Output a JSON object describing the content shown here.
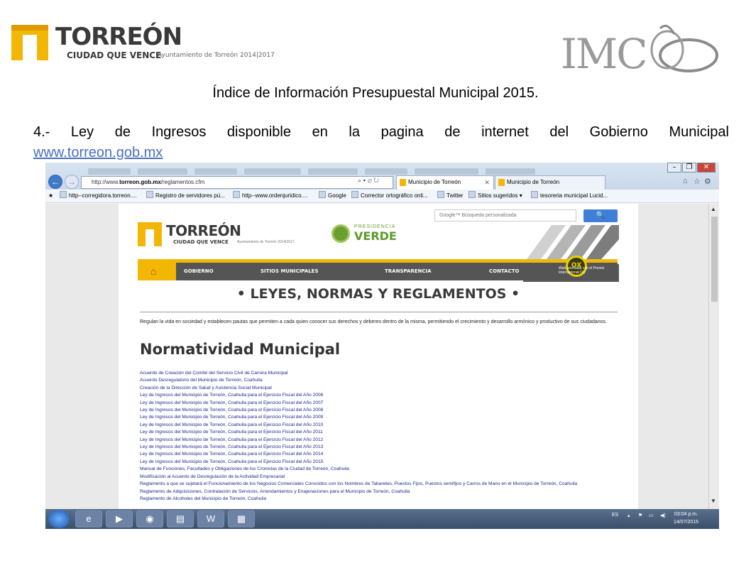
{
  "slide": {
    "logo_left": {
      "name": "TORREÓN",
      "tagline": "CIUDAD QUE VENCE",
      "subtitle": "Ayuntamiento de Torreón 2014|2017"
    },
    "logo_right": {
      "text": "IMC"
    },
    "title": "Índice de Información Presupuestal Municipal 2015.",
    "item_text": "4.- Ley de Ingresos disponible en la pagina de internet del Gobierno Municipal",
    "item_link": "www.torreon.gob.mx"
  },
  "browser": {
    "window_controls": [
      "–",
      "❐",
      "✕"
    ],
    "address_prefix": "http://www.",
    "address_bold": "torreon.gob.mx",
    "address_suffix": "/reglamentos.cfm",
    "tabs": [
      {
        "label": "Municipio de Torreón",
        "active": true
      },
      {
        "label": "Municipio de Torreón",
        "active": false
      }
    ],
    "favorites": [
      "http--corregidora.torreon....",
      "Registro de servidores pú...",
      "http--www.ordenjuridico....",
      "Google",
      "Corrector ortográfico onli...",
      "Twitter",
      "Sitios sugeridos ▾",
      "tesoreria municipal Lucid..."
    ]
  },
  "site": {
    "search_placeholder": "Google™ Búsqueda personalizada",
    "search_button": "🔍",
    "logo": {
      "name": "TORREÓN",
      "tagline": "CIUDAD QUE VENCE",
      "subtitle": "Ayuntamiento de Torreón 2014|2017"
    },
    "verde": {
      "top": "PRESIDENCIA",
      "big": "VERDE"
    },
    "nav": [
      "GOBIERNO",
      "SITIOS MUNICIPALES",
      "TRANSPARENCIA",
      "CONTACTO"
    ],
    "award_badge": "OX",
    "award_text": "Web premiada con el Premio Internacional OX",
    "heading": "• LEYES, NORMAS Y REGLAMENTOS •",
    "intro": "Regulan la vida en sociedad y establecen pautas que permiten a cada quien conocer sus derechos y deberes dentro de la misma, permitiendo el crecimiento y desarrollo armónico y productivo de sus ciudadanos.",
    "section_title": "Normatividad Municipal",
    "documents": [
      "Acuerdo de Creación del Comité del Servicio Civil de Carrera Municipal",
      "Acuerdo Desregulatorio del Municipio de Torreón, Coahuila",
      "Creación de la Dirección de Salud y Asistencia Social Municipal",
      "Ley de Ingresos del Municipio de Torreón, Coahuila para el Ejercicio Fiscal del Año 2006",
      "Ley de Ingresos del Municipio de Torreón, Coahuila para el Ejercicio Fiscal del Año 2007",
      "Ley de Ingresos del Municipio de Torreón, Coahuila para el Ejercicio Fiscal del Año 2008",
      "Ley de Ingresos del Municipio de Torreón, Coahuila para el Ejercicio Fiscal del Año 2009",
      "Ley de Ingresos del Municipio de Torreón, Coahuila para el Ejercicio Fiscal del Año 2010",
      "Ley de Ingresos del Municipio de Torreón, Coahuila para el Ejercicio Fiscal del Año 2011",
      "Ley de Ingresos del Municipio de Torreón, Coahuila para el Ejercicio Fiscal del Año 2012",
      "Ley de Ingresos del Municipio de Torreón, Coahuila para el Ejercicio Fiscal del Año 2013",
      "Ley de Ingresos del Municipio de Torreón, Coahuila para el Ejercicio Fiscal del Año 2014",
      "Ley de Ingresos del Municipio de Torreón, Coahuila para el Ejercicio Fiscal del Año 2015",
      "Manual de Funciones, Facultades y Obligaciones de los Cronistas de la Ciudad de Torreón, Coahuila",
      "Modificación al Acuerdo de Desregulación de la Actividad Empresarial",
      "Reglamento a que se sujetará el Funcionamiento de los Negocios Comerciales Conocidos con los Nombres de Tabaretes, Puestos Fijos, Puestos semifijos y Carros de Mano en el Municipio de Torreón, Coahuila",
      "Reglamento de Adquisiciones, Contratación de Servicios, Arrendamientos y Enajenaciones para el Municipio de Torreón, Coahuila",
      "Reglamento de Alcoholes del Municipio de Torreón, Coahuila"
    ]
  },
  "taskbar": {
    "apps": [
      "e",
      "▶",
      "◉",
      "▤",
      "W",
      "▦"
    ],
    "lang": "ES",
    "time": "03:04 p.m.",
    "date": "14/07/2015"
  },
  "colors": {
    "torreon_yellow": "#f2b705",
    "nav_gray": "#555555",
    "link_blue": "#4a6fc0",
    "verde_green": "#5d9a2a"
  }
}
